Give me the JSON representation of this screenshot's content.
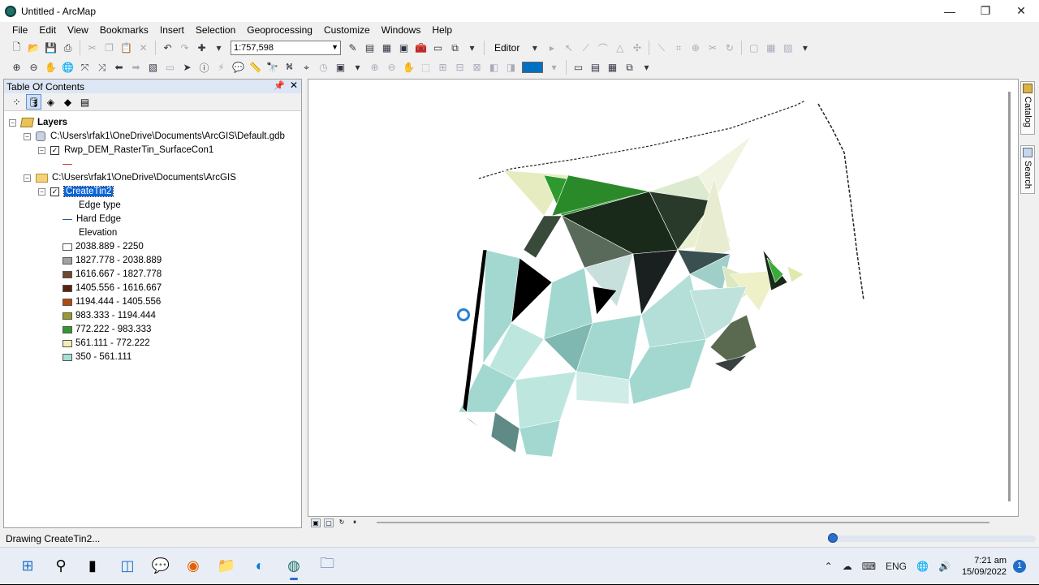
{
  "window": {
    "title": "Untitled - ArcMap",
    "controls": [
      "—",
      "❐",
      "✕"
    ]
  },
  "menu": [
    "File",
    "Edit",
    "View",
    "Bookmarks",
    "Insert",
    "Selection",
    "Geoprocessing",
    "Customize",
    "Windows",
    "Help"
  ],
  "toolbar": {
    "scale": "1:757,598",
    "editor_label": "Editor"
  },
  "toc": {
    "title": "Table Of Contents",
    "root": "Layers",
    "groups": [
      {
        "path": "C:\\Users\\rfak1\\OneDrive\\Documents\\ArcGIS\\Default.gdb",
        "layer": "Rwp_DEM_RasterTin_SurfaceCon1"
      },
      {
        "path": "C:\\Users\\rfak1\\OneDrive\\Documents\\ArcGIS",
        "layer": "CreateTin2"
      }
    ],
    "edge_type_label": "Edge type",
    "hard_edge_label": "Hard Edge",
    "elevation_label": "Elevation",
    "elevation_classes": [
      {
        "label": "2038.889 - 2250",
        "color": "#ffffff"
      },
      {
        "label": "1827.778 - 2038.889",
        "color": "#a3a3a3"
      },
      {
        "label": "1616.667 - 1827.778",
        "color": "#6e4a2e"
      },
      {
        "label": "1405.556 - 1616.667",
        "color": "#5a2410"
      },
      {
        "label": "1194.444 - 1405.556",
        "color": "#b34a0e"
      },
      {
        "label": "983.333 - 1194.444",
        "color": "#9a9a2e"
      },
      {
        "label": "772.222 - 983.333",
        "color": "#2e9a2e"
      },
      {
        "label": "561.111 - 772.222",
        "color": "#f0f0b4"
      },
      {
        "label": "350 - 561.111",
        "color": "#a3e0d6"
      }
    ]
  },
  "dock": {
    "catalog": "Catalog",
    "search": "Search"
  },
  "status": {
    "text": "Drawing CreateTin2...",
    "progress": 0.04
  },
  "taskbar": {
    "language": "ENG",
    "time": "7:21 am",
    "date": "15/09/2022",
    "notifications": "1"
  }
}
